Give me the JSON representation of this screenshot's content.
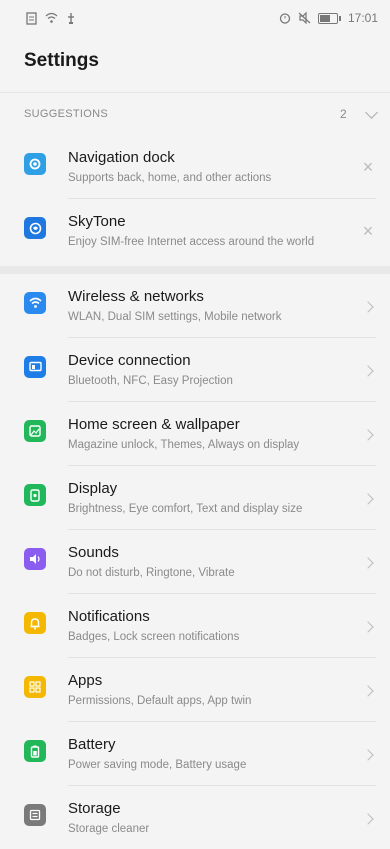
{
  "status": {
    "time": "17:01"
  },
  "page": {
    "title": "Settings"
  },
  "suggestions": {
    "header": "SUGGESTIONS",
    "count": "2",
    "items": [
      {
        "title": "Navigation dock",
        "subtitle": "Supports back, home, and other actions",
        "icon": "navigation-dock-icon",
        "color": "#2fa0e6"
      },
      {
        "title": "SkyTone",
        "subtitle": "Enjoy SIM-free Internet access around the world",
        "icon": "skytone-icon",
        "color": "#1e78e0"
      }
    ]
  },
  "settings": {
    "items": [
      {
        "title": "Wireless & networks",
        "subtitle": "WLAN, Dual SIM settings, Mobile network",
        "icon": "wifi-icon",
        "color": "#2a8af0"
      },
      {
        "title": "Device connection",
        "subtitle": "Bluetooth, NFC, Easy Projection",
        "icon": "device-connection-icon",
        "color": "#1f7de8"
      },
      {
        "title": "Home screen & wallpaper",
        "subtitle": "Magazine unlock, Themes, Always on display",
        "icon": "wallpaper-icon",
        "color": "#22b85a"
      },
      {
        "title": "Display",
        "subtitle": "Brightness, Eye comfort, Text and display size",
        "icon": "display-icon",
        "color": "#21b85c"
      },
      {
        "title": "Sounds",
        "subtitle": "Do not disturb, Ringtone, Vibrate",
        "icon": "sound-icon",
        "color": "#8a5cf0"
      },
      {
        "title": "Notifications",
        "subtitle": "Badges, Lock screen notifications",
        "icon": "bell-icon",
        "color": "#f5b800"
      },
      {
        "title": "Apps",
        "subtitle": "Permissions, Default apps, App twin",
        "icon": "apps-icon",
        "color": "#f5b800"
      },
      {
        "title": "Battery",
        "subtitle": "Power saving mode, Battery usage",
        "icon": "battery-icon",
        "color": "#22b85a"
      },
      {
        "title": "Storage",
        "subtitle": "Storage cleaner",
        "icon": "storage-icon",
        "color": "#7a7a7a"
      }
    ]
  }
}
